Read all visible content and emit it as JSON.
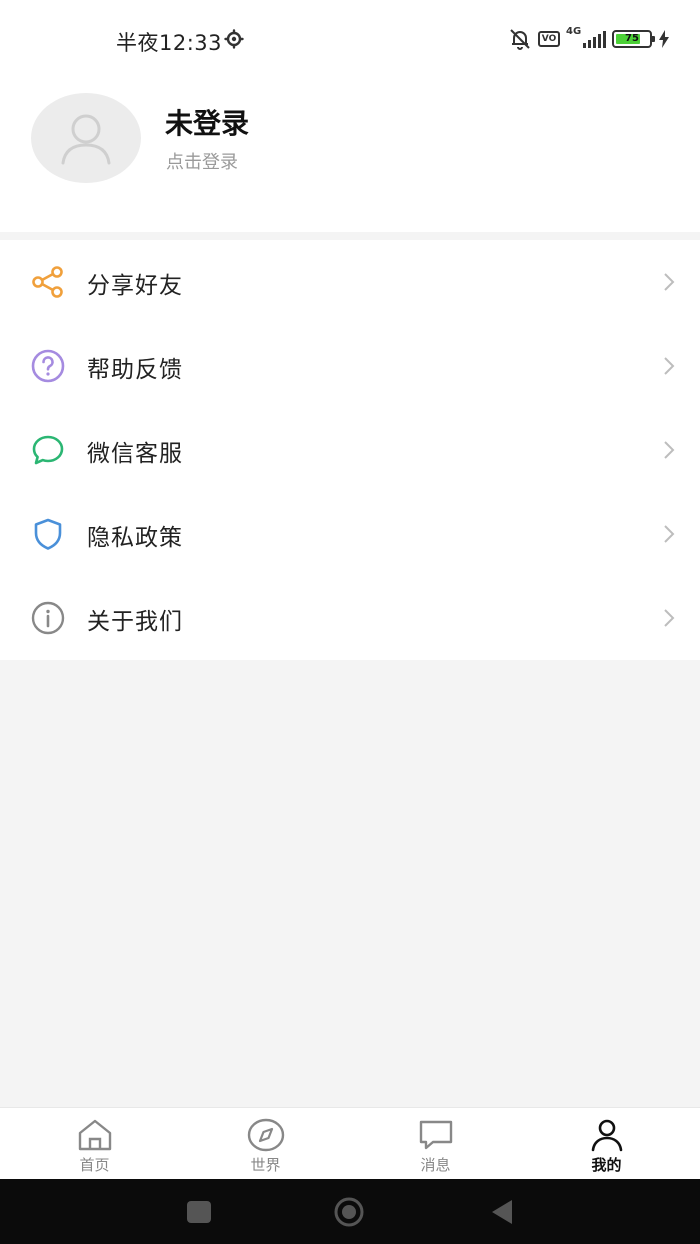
{
  "status_bar": {
    "time": "半夜12:33",
    "vo_label": "VO",
    "network": "4G",
    "battery": "75",
    "battery_level": 0.75
  },
  "profile": {
    "name": "未登录",
    "subtitle": "点击登录",
    "avatar_icon": "user-silhouette-icon"
  },
  "menu": {
    "items": [
      {
        "label": "分享好友",
        "icon": "share-icon",
        "color": "#f0a03c"
      },
      {
        "label": "帮助反馈",
        "icon": "question-circle-icon",
        "color": "#a58be0"
      },
      {
        "label": "微信客服",
        "icon": "chat-bubble-icon",
        "color": "#2bb673"
      },
      {
        "label": "隐私政策",
        "icon": "shield-icon",
        "color": "#4a90d9"
      },
      {
        "label": "关于我们",
        "icon": "info-circle-icon",
        "color": "#888888"
      }
    ]
  },
  "tabbar": {
    "tabs": [
      {
        "label": "首页",
        "icon": "home-icon",
        "active": false
      },
      {
        "label": "世界",
        "icon": "compass-icon",
        "active": false
      },
      {
        "label": "消息",
        "icon": "message-icon",
        "active": false
      },
      {
        "label": "我的",
        "icon": "profile-icon",
        "active": true
      }
    ]
  },
  "colors": {
    "background": "#f4f4f4",
    "surface": "#ffffff",
    "text_primary": "#111111",
    "text_secondary": "#9a9a9a",
    "tab_inactive": "#888888",
    "tab_active": "#111111"
  }
}
